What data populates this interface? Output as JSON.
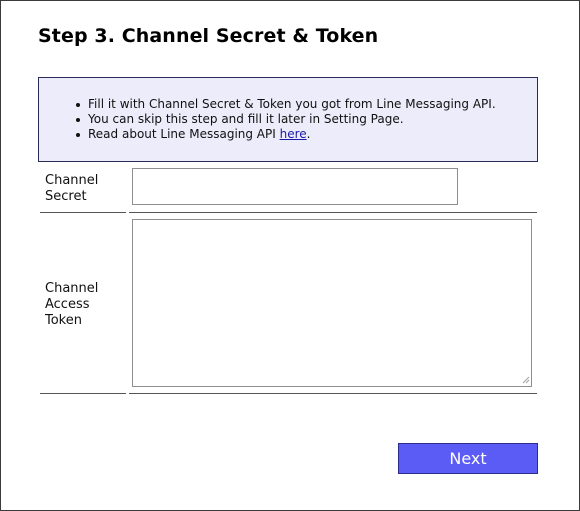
{
  "page": {
    "title": "Step 3. Channel Secret & Token"
  },
  "info": {
    "items": [
      "Fill it with Channel Secret & Token you got from Line Messaging API.",
      "You can skip this step and fill it later in Setting Page.",
      "Read about Line Messaging API "
    ],
    "link_text": "here",
    "link_suffix": "."
  },
  "form": {
    "channel_secret_label": "Channel Secret",
    "channel_secret_value": "",
    "channel_access_token_label": "Channel Access Token",
    "channel_access_token_value": ""
  },
  "actions": {
    "next_label": "Next"
  },
  "colors": {
    "info_background": "#ececfb",
    "button_background": "#5b5bf6",
    "link": "#1a1aa6"
  }
}
